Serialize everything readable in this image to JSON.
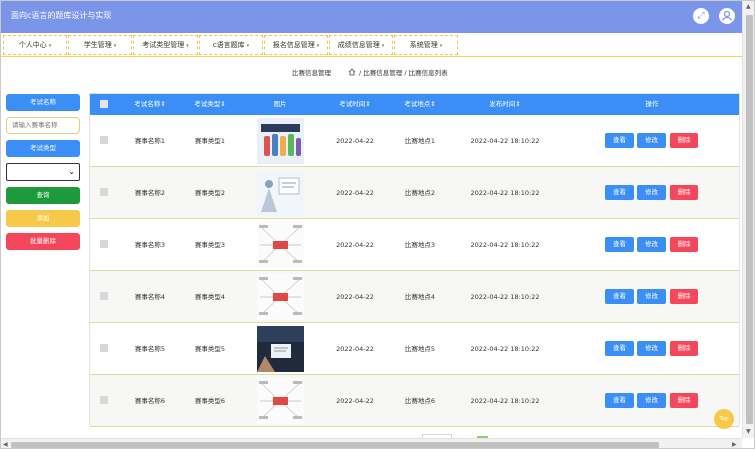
{
  "header": {
    "title": "面向c语言的题库设计与实现",
    "fullscreen_icon": "expand-icon",
    "user_icon": "user-icon"
  },
  "nav": [
    {
      "label": "个人中心"
    },
    {
      "label": "学生管理"
    },
    {
      "label": "考试类型管理"
    },
    {
      "label": "c语言题库"
    },
    {
      "label": "报名信息管理"
    },
    {
      "label": "成绩信息管理"
    },
    {
      "label": "系统管理"
    }
  ],
  "breadcrumb": {
    "left": "比赛信息管理",
    "path": "/ 比赛信息管理 / 比赛信息列表"
  },
  "sidebar": {
    "name_label": "考试名称",
    "name_placeholder": "请输入赛事名称",
    "type_label": "考试类型",
    "type_value": "",
    "search": "查询",
    "add": "添加",
    "batch_delete": "批量删除"
  },
  "table": {
    "headers": [
      "考试名称",
      "考试类型",
      "图片",
      "考试时间",
      "考试地点",
      "发布时间",
      "操作"
    ],
    "actions": {
      "view": "查看",
      "edit": "修改",
      "delete": "删除"
    },
    "rows": [
      {
        "name": "赛事名称1",
        "type": "赛事类型1",
        "time": "2022-04-22",
        "place": "比赛地点1",
        "published": "2022-04-22 18:10:22"
      },
      {
        "name": "赛事名称2",
        "type": "赛事类型2",
        "time": "2022-04-22",
        "place": "比赛地点2",
        "published": "2022-04-22 18:10:22"
      },
      {
        "name": "赛事名称3",
        "type": "赛事类型3",
        "time": "2022-04-22",
        "place": "比赛地点3",
        "published": "2022-04-22 18:10:22"
      },
      {
        "name": "赛事名称4",
        "type": "赛事类型4",
        "time": "2022-04-22",
        "place": "比赛地点4",
        "published": "2022-04-22 18:10:22"
      },
      {
        "name": "赛事名称5",
        "type": "赛事类型5",
        "time": "2022-04-22",
        "place": "比赛地点5",
        "published": "2022-04-22 18:10:22"
      },
      {
        "name": "赛事名称6",
        "type": "赛事类型6",
        "time": "2022-04-22",
        "place": "比赛地点6",
        "published": "2022-04-22 18:10:22"
      }
    ]
  },
  "back_to_top": "Top"
}
